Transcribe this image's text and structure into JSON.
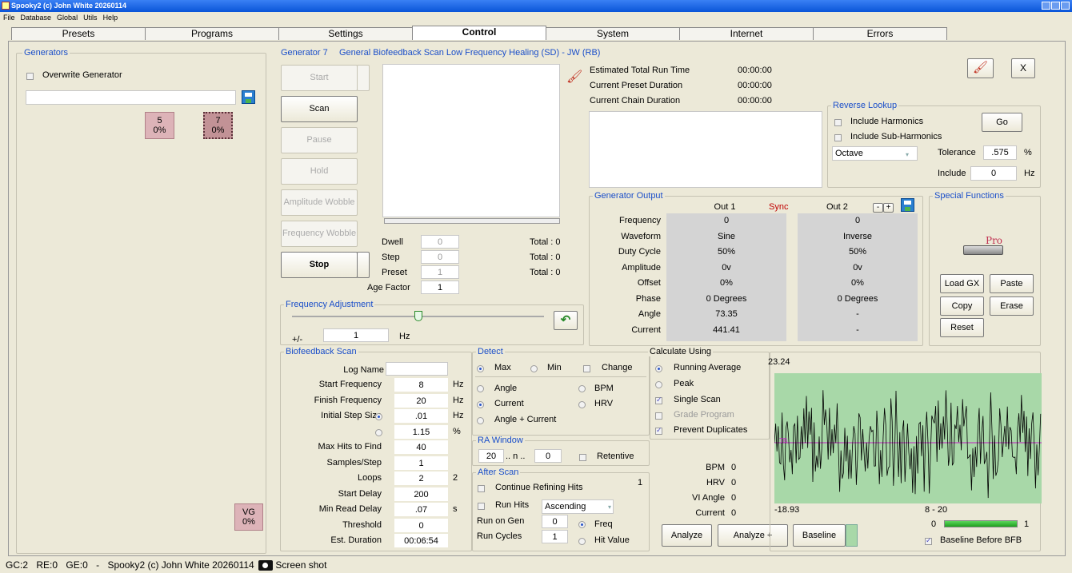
{
  "window": {
    "title": "Spooky2 (c) John White 20260114"
  },
  "menu": [
    "File",
    "Database",
    "Global",
    "Utils",
    "Help"
  ],
  "tabs": [
    "Presets",
    "Programs",
    "Settings",
    "Control",
    "System",
    "Internet",
    "Errors"
  ],
  "generators": {
    "title": "Generators",
    "overwrite": "Overwrite Generator",
    "tiles": [
      {
        "num": "5",
        "pct": "0%"
      },
      {
        "num": "7",
        "pct": "0%"
      }
    ],
    "vg": {
      "num": "VG",
      "pct": "0%"
    }
  },
  "gen": {
    "header_num": "Generator 7",
    "header_prog": "General Biofeedback Scan Low Frequency Healing (SD) - JW (RB)",
    "buttons": {
      "start": "Start",
      "scan": "Scan",
      "pause": "Pause",
      "hold": "Hold",
      "amp": "Amplitude Wobble",
      "freq": "Frequency Wobble",
      "stop": "Stop"
    },
    "dwell": {
      "label": "Dwell",
      "val": "0",
      "total": "Total : 0"
    },
    "step": {
      "label": "Step",
      "val": "0",
      "total": "Total : 0"
    },
    "preset": {
      "label": "Preset",
      "val": "1",
      "total": "Total : 0"
    },
    "age": {
      "label": "Age Factor",
      "val": "1"
    }
  },
  "runinfo": {
    "est_label": "Estimated Total Run Time",
    "est_val": "00:00:00",
    "cur_label": "Current Preset Duration",
    "cur_val": "00:00:00",
    "chain_label": "Current Chain Duration",
    "chain_val": "00:00:00",
    "close": "X"
  },
  "reverse": {
    "title": "Reverse Lookup",
    "harm": "Include Harmonics",
    "sub": "Include Sub-Harmonics",
    "go": "Go",
    "octave": "Octave",
    "tol_label": "Tolerance",
    "tol_val": ".575",
    "tol_unit": "%",
    "inc_label": "Include",
    "inc_val": "0",
    "inc_unit": "Hz"
  },
  "output": {
    "title": "Generator Output",
    "out1": "Out 1",
    "sync": "Sync",
    "out2": "Out 2",
    "minus": "-",
    "plus": "+",
    "rows": [
      {
        "label": "Frequency",
        "o1": "0",
        "o2": "0"
      },
      {
        "label": "Waveform",
        "o1": "Sine",
        "o2": "Inverse"
      },
      {
        "label": "Duty Cycle",
        "o1": "50%",
        "o2": "50%"
      },
      {
        "label": "Amplitude",
        "o1": "0v",
        "o2": "0v"
      },
      {
        "label": "Offset",
        "o1": "0%",
        "o2": "0%"
      },
      {
        "label": "Phase",
        "o1": "0 Degrees",
        "o2": "0 Degrees"
      },
      {
        "label": "Angle",
        "o1": "73.35",
        "o2": "-"
      },
      {
        "label": "Current",
        "o1": "441.41",
        "o2": "-"
      }
    ]
  },
  "special": {
    "title": "Special Functions",
    "pro": "Pro",
    "load": "Load GX",
    "paste": "Paste",
    "copy": "Copy",
    "erase": "Erase",
    "reset": "Reset"
  },
  "freqadj": {
    "title": "Frequency Adjustment",
    "pm": "+/-",
    "val": "1",
    "unit": "Hz",
    "slider_level": 0.5
  },
  "bfb": {
    "title": "Biofeedback Scan",
    "log": "Log Name",
    "rows": [
      {
        "label": "Start Frequency",
        "val": "8",
        "unit": "Hz"
      },
      {
        "label": "Finish Frequency",
        "val": "20",
        "unit": "Hz"
      },
      {
        "label": "Initial Step Size",
        "val": ".01",
        "unit": "Hz"
      },
      {
        "label": "",
        "val": "1.15",
        "unit": "%"
      },
      {
        "label": "Max Hits to Find",
        "val": "40",
        "unit": ""
      },
      {
        "label": "Samples/Step",
        "val": "1",
        "unit": ""
      },
      {
        "label": "Loops",
        "val": "2",
        "unit": "2"
      },
      {
        "label": "Start Delay",
        "val": "200",
        "unit": ""
      },
      {
        "label": "Min Read Delay",
        "val": ".07",
        "unit": "s"
      },
      {
        "label": "Threshold",
        "val": "0",
        "unit": ""
      },
      {
        "label": "Est. Duration",
        "val": "00:06:54",
        "unit": ""
      }
    ]
  },
  "detect": {
    "title": "Detect",
    "max": "Max",
    "min": "Min",
    "change": "Change",
    "angle": "Angle",
    "bpm": "BPM",
    "current": "Current",
    "hrv": "HRV",
    "anglecur": "Angle + Current"
  },
  "ra": {
    "title": "RA Window",
    "v1": "20",
    "n": ".. n ..",
    "v2": "0",
    "ret": "Retentive"
  },
  "after": {
    "title": "After Scan",
    "cont": "Continue Refining Hits",
    "cnum": "1",
    "runhits": "Run Hits",
    "order": "Ascending",
    "rongen": "Run on Gen",
    "rongen_val": "0",
    "cycles": "Run Cycles",
    "cycles_val": "1",
    "freq": "Freq",
    "hitval": "Hit Value"
  },
  "calc": {
    "title": "Calculate Using",
    "ravg": "Running Average",
    "peak": "Peak",
    "single": "Single Scan",
    "grade": "Grade Program",
    "dup": "Prevent Duplicates"
  },
  "stats": {
    "bpm": "BPM",
    "bpm_v": "0",
    "hrv": "HRV",
    "hrv_v": "0",
    "via": "VI Angle",
    "via_v": "0",
    "cur": "Current",
    "cur_v": "0",
    "analyze": "Analyze",
    "analyzep": "Analyze +",
    "baseline": "Baseline"
  },
  "graph": {
    "top": "23.24",
    "bottom": "-18.93",
    "range": "8 - 20",
    "marker": "TB",
    "bar_min": "0",
    "bar_max": "1",
    "bar_level": 1,
    "bfb_label": "Baseline Before BFB"
  },
  "status": {
    "gc": "GC:2",
    "re": "RE:0",
    "ge": "GE:0",
    "dash": "-",
    "text": "Spooky2 (c) John White 20260114",
    "shot": "Screen shot"
  },
  "colors": {
    "tab_active": "#ffffff",
    "title_blue": "#1a4ec9",
    "graph_bg": "#a8d8a8",
    "sync": "#c00000"
  }
}
